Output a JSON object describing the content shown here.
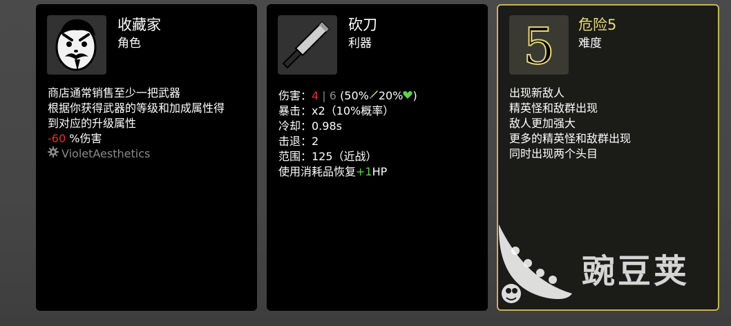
{
  "character": {
    "title": "收藏家",
    "subtitle": "角色",
    "icon": "collector-portrait-icon",
    "lines": [
      "商店通常销售至少一把武器",
      "根据你获得武器的等级和加成属性得",
      "到对应的升级属性"
    ],
    "penalty_value": "-60",
    "penalty_label": "%伤害",
    "mod_name": "VioletAesthetics"
  },
  "weapon": {
    "title": "砍刀",
    "subtitle": "利器",
    "icon": "cleaver-icon",
    "damage_label": "伤害：",
    "damage_value": "4",
    "damage_sep": "|",
    "damage_base": "6",
    "damage_open": "(50%",
    "damage_mid": "20%",
    "damage_close": ")",
    "crit": "暴击：x2（10%概率）",
    "cooldown": "冷却：0.98s",
    "knockback": "击退：2",
    "range": "范围：125（近战）",
    "heal_prefix": "使用消耗品恢复",
    "heal_value": "+1",
    "heal_suffix": "HP"
  },
  "danger": {
    "title": "危险5",
    "subtitle": "难度",
    "icon_numeral": "5",
    "lines": [
      "出现新敌人",
      "精英怪和敌群出现",
      "敌人更加强大",
      "更多的精英怪和敌群出现",
      "同时出现两个头目"
    ]
  },
  "watermark": {
    "text": "豌豆荚"
  },
  "colors": {
    "accent_gold": "#c8b45a",
    "title_gold": "#e8d97a",
    "negative": "#e33232",
    "positive": "#5fd24f"
  }
}
